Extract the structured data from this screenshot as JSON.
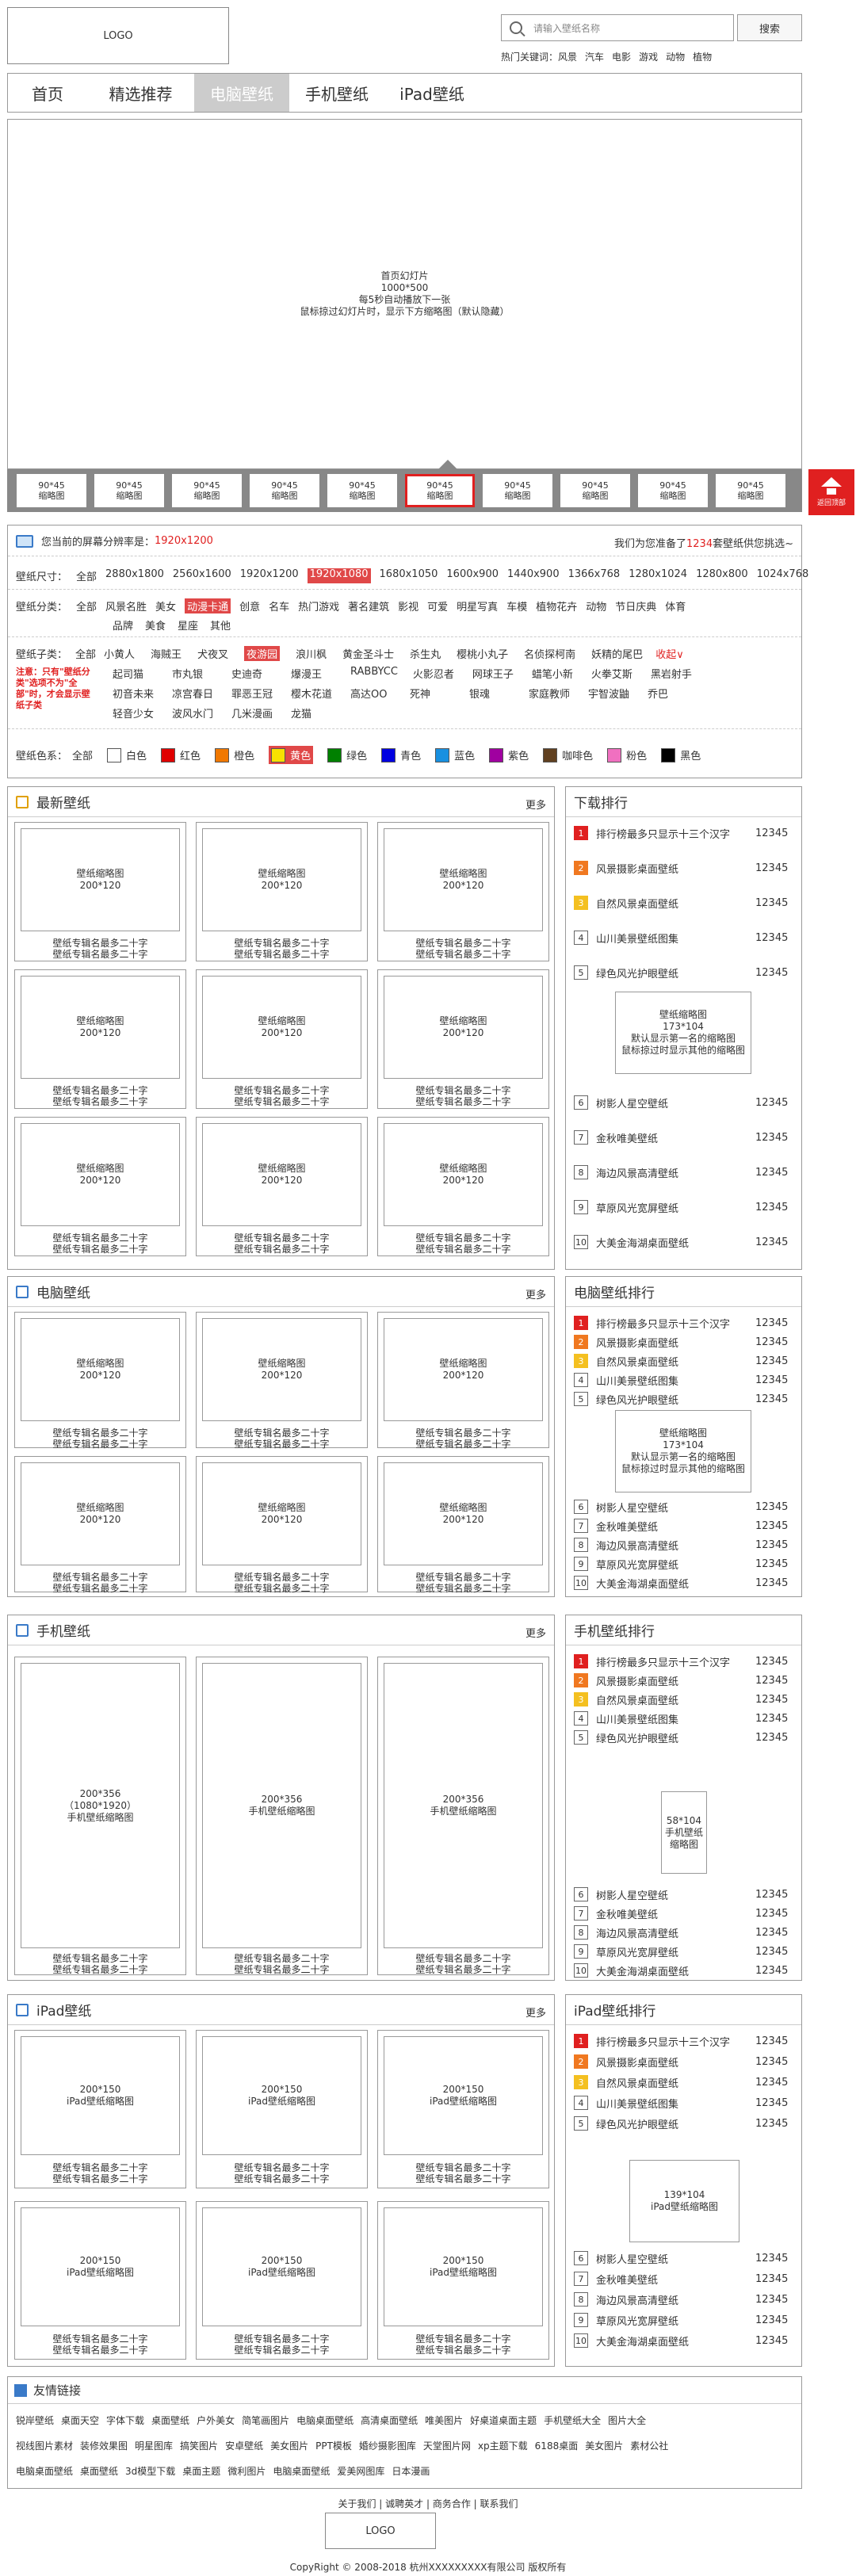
{
  "header": {
    "logo": "LOGO",
    "search_placeholder": "请输入壁纸名称",
    "search_button": "搜索",
    "hot_label": "热门关键词：",
    "hot": [
      "风景",
      "汽车",
      "电影",
      "游戏",
      "动物",
      "植物"
    ]
  },
  "nav": [
    "首页",
    "精选推荐",
    "电脑壁纸",
    "手机壁纸",
    "iPad壁纸"
  ],
  "slider": {
    "text": [
      "首页幻灯片",
      "1000*500",
      "每5秒自动播放下一张",
      "鼠标掠过幻灯片时，显示下方缩略图（默认隐藏）"
    ],
    "thumb": [
      "90*45",
      "缩略图"
    ]
  },
  "backtop": "返回顶部",
  "resolution": {
    "prefix": "您当前的屏幕分辨率是：",
    "value": "1920x1200",
    "right_prefix": "我们为您准备了",
    "count": "1234",
    "right_suffix": "套壁纸供您挑选~"
  },
  "size": {
    "label": "壁纸尺寸：",
    "items": [
      "全部",
      "2880x1800",
      "2560x1600",
      "1920x1200",
      "1920x1080",
      "1680x1050",
      "1600x900",
      "1440x900",
      "1366x768",
      "1280x1024",
      "1280x800",
      "1024x768"
    ]
  },
  "category": {
    "label": "壁纸分类：",
    "row1": [
      "全部",
      "风景名胜",
      "美女",
      "动漫卡通",
      "创意",
      "名车",
      "热门游戏",
      "著名建筑",
      "影视",
      "可爱",
      "明星写真",
      "车模",
      "植物花卉",
      "动物",
      "节日庆典",
      "体育"
    ],
    "row2": [
      "品牌",
      "美食",
      "星座",
      "其他"
    ]
  },
  "subcat": {
    "label": "壁纸子类：",
    "collapse": "收起∨",
    "note": "注意：只有\"壁纸分类\"选项不为\"全部\"时，才会显示壁纸子类",
    "row1": [
      "全部",
      "小黄人",
      "海贼王",
      "犬夜叉",
      "夜游园",
      "浪川枫",
      "黄金圣斗士",
      "杀生丸",
      "樱桃小丸子",
      "名侦探柯南",
      "妖精的尾巴"
    ],
    "row2": [
      "起司猫",
      "市丸银",
      "史迪奇",
      "爆漫王",
      "RABBYCC",
      "火影忍者",
      "网球王子",
      "蜡笔小新",
      "火拳艾斯",
      "黑岩射手"
    ],
    "row3": [
      "初音未来",
      "凉宫春日",
      "罪恶王冠",
      "樱木花道",
      "高达OO",
      "死神",
      "银魂",
      "家庭教师",
      "宇智波鼬",
      "乔巴"
    ],
    "row4": [
      "轻音少女",
      "波风水门",
      "几米漫画",
      "龙猫"
    ]
  },
  "colors": {
    "label": "壁纸色系：",
    "items": [
      {
        "name": "全部"
      },
      {
        "name": "白色",
        "c": "#ffffff"
      },
      {
        "name": "红色",
        "c": "#e00000"
      },
      {
        "name": "橙色",
        "c": "#f07800"
      },
      {
        "name": "黄色",
        "c": "#f8e000"
      },
      {
        "name": "绿色",
        "c": "#008000"
      },
      {
        "name": "青色",
        "c": "#0000e0"
      },
      {
        "name": "蓝色",
        "c": "#1890e0"
      },
      {
        "name": "紫色",
        "c": "#a000a0"
      },
      {
        "name": "咖啡色",
        "c": "#604020"
      },
      {
        "name": "粉色",
        "c": "#f070c0"
      },
      {
        "name": "黑色",
        "c": "#000000"
      }
    ]
  },
  "sections": {
    "latest": "最新壁纸",
    "pc": "电脑壁纸",
    "phone": "手机壁纸",
    "ipad": "iPad壁纸",
    "more": "更多"
  },
  "card": {
    "pc": [
      "壁纸缩略图",
      "200*120"
    ],
    "cap": [
      "壁纸专辑名最多二十字",
      "壁纸专辑名最多二十字"
    ],
    "phone_first": [
      "200*356",
      "（1080*1920）",
      "手机壁纸缩略图"
    ],
    "phone": [
      "200*356",
      "手机壁纸缩略图"
    ],
    "ipad": [
      "200*150",
      "iPad壁纸缩略图"
    ]
  },
  "ranks": {
    "download": "下载排行",
    "pc": "电脑壁纸排行",
    "phone": "手机壁纸排行",
    "ipad": "iPad壁纸排行"
  },
  "rank_items": [
    "排行榜最多只显示十三个汉字",
    "风景摄影桌面壁纸",
    "自然风景桌面壁纸",
    "山川美景壁纸图集",
    "绿色风光护眼壁纸",
    "树影人星空壁纸",
    "金秋唯美壁纸",
    "海边风景高清壁纸",
    "草原风光宽屏壁纸",
    "大美金海湖桌面壁纸"
  ],
  "rank_value": "12345",
  "rank_imgs": {
    "download": [
      "壁纸缩略图",
      "173*104",
      "默认显示第一名的缩略图",
      "鼠标掠过时显示其他的缩略图"
    ],
    "phone": [
      "58*104",
      "手机壁纸",
      "缩略图"
    ],
    "ipad": [
      "139*104",
      "iPad壁纸缩略图"
    ]
  },
  "links": {
    "title": "友情链接",
    "row1": [
      "锐岸壁纸",
      "桌面天空",
      "字体下载",
      "桌面壁纸",
      "户外美女",
      "简笔画图片",
      "电脑桌面壁纸",
      "高清桌面壁纸",
      "唯美图片",
      "好桌道桌面主题",
      "手机壁纸大全",
      "图片大全"
    ],
    "row2": [
      "视线图片素材",
      "装修效果图",
      "明星图库",
      "搞笑图片",
      "安卓壁纸",
      "美女图片",
      "PPT模板",
      "婚纱摄影图库",
      "天堂图片网",
      "xp主题下载",
      "6188桌面",
      "美女图片",
      "素材公社"
    ],
    "row3": [
      "电脑桌面壁纸",
      "桌面壁纸",
      "3d模型下载",
      "桌面主题",
      "微利图片",
      "电脑桌面壁纸",
      "爱美网图库",
      "日本漫画"
    ]
  },
  "footer": {
    "links": "关于我们 | 诚聘英才 | 商务合作 | 联系我们",
    "logo": "LOGO",
    "copyright": "CopyRight © 2008-2018 杭州XXXXXXXXX有限公司 版权所有"
  }
}
